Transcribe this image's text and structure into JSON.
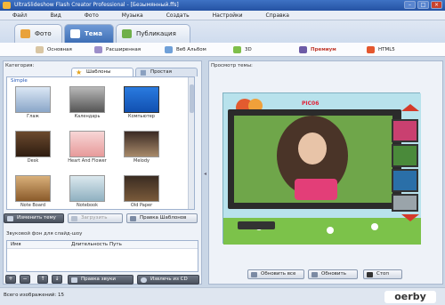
{
  "window": {
    "title": "UltraSlideshow Flash Creator Professional - [Безымянный.ffs]"
  },
  "menu": [
    "Файл",
    "Вид",
    "Фото",
    "Музыка",
    "Создать",
    "Настройки",
    "Справка"
  ],
  "main_tabs": [
    {
      "label": "Фото"
    },
    {
      "label": "Тема"
    },
    {
      "label": "Публикация"
    }
  ],
  "sub_tabs": [
    {
      "label": "Основная"
    },
    {
      "label": "Расширенная"
    },
    {
      "label": "Веб Альбом"
    },
    {
      "label": "3D"
    },
    {
      "label": "Премиум"
    },
    {
      "label": "HTML5"
    }
  ],
  "left": {
    "category_label": "Категория:",
    "tabs": [
      {
        "label": "Шаблоны"
      },
      {
        "label": "Простая"
      }
    ],
    "group": "Simple",
    "templates": [
      {
        "label": "Глаж"
      },
      {
        "label": "Календарь"
      },
      {
        "label": "Компьютер"
      },
      {
        "label": "Desk"
      },
      {
        "label": "Heart And Flower"
      },
      {
        "label": "Melody"
      },
      {
        "label": "Note Board"
      },
      {
        "label": "Notebook"
      },
      {
        "label": "Old Paper"
      }
    ],
    "buttons": {
      "change_theme": "Изменить тему",
      "load": "Загрузить",
      "edit_template": "Правка Шаблонов"
    },
    "sound_label": "Звуковой фон для слайд-шоу",
    "sound_columns": [
      "Имя",
      "Длительность",
      "Путь"
    ],
    "sound_buttons": {
      "edit_sound": "Правка звуки",
      "extract_cd": "Извлечь из CD"
    }
  },
  "right": {
    "preview_label": "Просмотр темы:",
    "preview_caption": "PIC06",
    "buttons": {
      "refresh_all": "Обновить все",
      "refresh": "Обновить",
      "stop": "Стоп"
    }
  },
  "status": {
    "text": "Всего изображений: 15"
  },
  "watermark": "oerby"
}
